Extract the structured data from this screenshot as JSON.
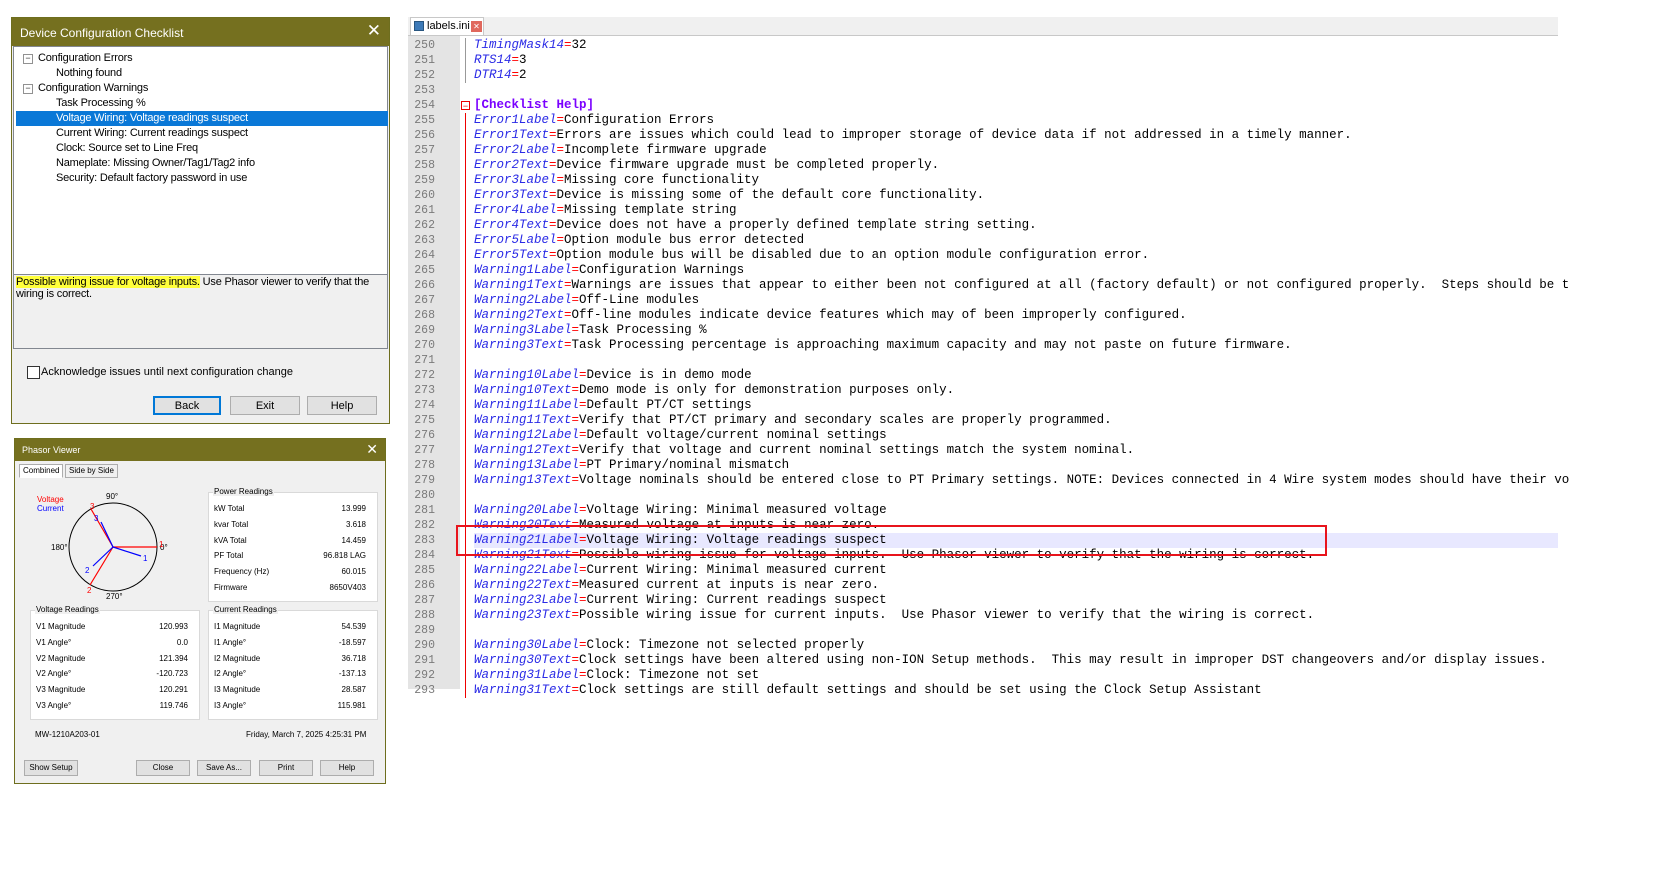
{
  "checklist": {
    "title": "Device Configuration Checklist",
    "close_glyph": "✕",
    "tree": [
      {
        "label": "Configuration Errors",
        "toggle": "−",
        "level": 0
      },
      {
        "label": "Nothing found",
        "level": 1
      },
      {
        "label": "Configuration Warnings",
        "toggle": "−",
        "level": 0
      },
      {
        "label": "Task Processing %",
        "level": 1
      },
      {
        "label": "Voltage Wiring: Voltage readings suspect",
        "level": 1,
        "selected": true
      },
      {
        "label": "Current Wiring: Current readings suspect",
        "level": 1
      },
      {
        "label": "Clock: Source set to Line Freq",
        "level": 1
      },
      {
        "label": "Nameplate: Missing Owner/Tag1/Tag2 info",
        "level": 1
      },
      {
        "label": "Security: Default factory password in use",
        "level": 1
      }
    ],
    "help_highlight": "Possible wiring issue for voltage inputs.",
    "help_rest": " Use Phasor viewer to verify that the wiring is correct.",
    "acknowledge_label": "Acknowledge issues until next configuration change",
    "acknowledge_checked": false,
    "buttons": {
      "back": "Back",
      "exit": "Exit",
      "help": "Help"
    }
  },
  "phasor": {
    "title": "Phasor Viewer",
    "close_glyph": "✕",
    "tabs": [
      "Combined",
      "Side by Side"
    ],
    "legend": {
      "voltage": "Voltage",
      "current": "Current"
    },
    "angles": {
      "top": "90°",
      "left": "180°",
      "right": "0°",
      "bottom": "270°"
    },
    "vector_labels": {
      "v1": "1",
      "v2": "2",
      "v3": "3",
      "i1": "1",
      "i2": "2",
      "i3": "3"
    },
    "colors": {
      "voltage": "#ff0000",
      "current": "#0000ff"
    },
    "power": {
      "title": "Power Readings",
      "rows": [
        {
          "label": "kW Total",
          "value": "13.999"
        },
        {
          "label": "kvar Total",
          "value": "3.618"
        },
        {
          "label": "kVA Total",
          "value": "14.459"
        },
        {
          "label": "PF Total",
          "value": "96.818 LAG"
        },
        {
          "label": "Frequency (Hz)",
          "value": "60.015"
        },
        {
          "label": "Firmware",
          "value": "8650V403"
        }
      ]
    },
    "voltage": {
      "title": "Voltage Readings",
      "rows": [
        {
          "label": "V1 Magnitude",
          "value": "120.993"
        },
        {
          "label": "V1 Angle°",
          "value": "0.0"
        },
        {
          "label": "V2 Magnitude",
          "value": "121.394"
        },
        {
          "label": "V2 Angle°",
          "value": "-120.723"
        },
        {
          "label": "V3 Magnitude",
          "value": "120.291"
        },
        {
          "label": "V3 Angle°",
          "value": "119.746"
        }
      ]
    },
    "current": {
      "title": "Current Readings",
      "rows": [
        {
          "label": "I1 Magnitude",
          "value": "54.539"
        },
        {
          "label": "I1 Angle°",
          "value": "-18.597"
        },
        {
          "label": "I2 Magnitude",
          "value": "36.718"
        },
        {
          "label": "I2 Angle°",
          "value": "-137.13"
        },
        {
          "label": "I3 Magnitude",
          "value": "28.587"
        },
        {
          "label": "I3 Angle°",
          "value": "115.981"
        }
      ]
    },
    "device": "MW-1210A203-01",
    "timestamp": "Friday, March 7, 2025 4:25:31 PM",
    "buttons": {
      "show_setup": "Show Setup",
      "close": "Close",
      "save_as": "Save As...",
      "print": "Print",
      "help": "Help"
    }
  },
  "editor": {
    "tab_name": "labels.ini",
    "tab_close": "✕",
    "lines": [
      {
        "n": "250",
        "key": "TimingMask14",
        "val": "32"
      },
      {
        "n": "251",
        "key": "RTS14",
        "val": "3"
      },
      {
        "n": "252",
        "key": "DTR14",
        "val": "2"
      },
      {
        "n": "253"
      },
      {
        "n": "254",
        "section": "[Checklist Help]"
      },
      {
        "n": "255",
        "key": "Error1Label",
        "val": "Configuration Errors"
      },
      {
        "n": "256",
        "key": "Error1Text",
        "val": "Errors are issues which could lead to improper storage of device data if not addressed in a timely manner."
      },
      {
        "n": "257",
        "key": "Error2Label",
        "val": "Incomplete firmware upgrade"
      },
      {
        "n": "258",
        "key": "Error2Text",
        "val": "Device firmware upgrade must be completed properly."
      },
      {
        "n": "259",
        "key": "Error3Label",
        "val": "Missing core functionality"
      },
      {
        "n": "260",
        "key": "Error3Text",
        "val": "Device is missing some of the default core functionality."
      },
      {
        "n": "261",
        "key": "Error4Label",
        "val": "Missing template string"
      },
      {
        "n": "262",
        "key": "Error4Text",
        "val": "Device does not have a properly defined template string setting."
      },
      {
        "n": "263",
        "key": "Error5Label",
        "val": "Option module bus error detected"
      },
      {
        "n": "264",
        "key": "Error5Text",
        "val": "Option module bus will be disabled due to an option module configuration error."
      },
      {
        "n": "265",
        "key": "Warning1Label",
        "val": "Configuration Warnings"
      },
      {
        "n": "266",
        "key": "Warning1Text",
        "val": "Warnings are issues that appear to either been not configured at all (factory default) or not configured properly.  Steps should be t"
      },
      {
        "n": "267",
        "key": "Warning2Label",
        "val": "Off-Line modules"
      },
      {
        "n": "268",
        "key": "Warning2Text",
        "val": "Off-line modules indicate device features which may of been improperly configured."
      },
      {
        "n": "269",
        "key": "Warning3Label",
        "val": "Task Processing %"
      },
      {
        "n": "270",
        "key": "Warning3Text",
        "val": "Task Processing percentage is approaching maximum capacity and may not paste on future firmware."
      },
      {
        "n": "271"
      },
      {
        "n": "272",
        "key": "Warning10Label",
        "val": "Device is in demo mode"
      },
      {
        "n": "273",
        "key": "Warning10Text",
        "val": "Demo mode is only for demonstration purposes only."
      },
      {
        "n": "274",
        "key": "Warning11Label",
        "val": "Default PT/CT settings"
      },
      {
        "n": "275",
        "key": "Warning11Text",
        "val": "Verify that PT/CT primary and secondary scales are properly programmed."
      },
      {
        "n": "276",
        "key": "Warning12Label",
        "val": "Default voltage/current nominal settings"
      },
      {
        "n": "277",
        "key": "Warning12Text",
        "val": "Verify that voltage and current nominal settings match the system nominal."
      },
      {
        "n": "278",
        "key": "Warning13Label",
        "val": "PT Primary/nominal mismatch"
      },
      {
        "n": "279",
        "key": "Warning13Text",
        "val": "Voltage nominals should be entered close to PT Primary settings. NOTE: Devices connected in 4 Wire system modes should have their vo"
      },
      {
        "n": "280"
      },
      {
        "n": "281",
        "key": "Warning20Label",
        "val": "Voltage Wiring: Minimal measured voltage"
      },
      {
        "n": "282",
        "key": "Warning20Text",
        "val": "Measured voltage at inputs is near zero."
      },
      {
        "n": "283",
        "key": "Warning21Label",
        "val": "Voltage Wiring: Voltage readings suspect",
        "current": true
      },
      {
        "n": "284",
        "key": "Warning21Text",
        "val": "Possible wiring issue for voltage inputs.  Use Phasor viewer to verify that the wiring is correct."
      },
      {
        "n": "285",
        "key": "Warning22Label",
        "val": "Current Wiring: Minimal measured current"
      },
      {
        "n": "286",
        "key": "Warning22Text",
        "val": "Measured current at inputs is near zero."
      },
      {
        "n": "287",
        "key": "Warning23Label",
        "val": "Current Wiring: Current readings suspect"
      },
      {
        "n": "288",
        "key": "Warning23Text",
        "val": "Possible wiring issue for current inputs.  Use Phasor viewer to verify that the wiring is correct."
      },
      {
        "n": "289"
      },
      {
        "n": "290",
        "key": "Warning30Label",
        "val": "Clock: Timezone not selected properly"
      },
      {
        "n": "291",
        "key": "Warning30Text",
        "val": "Clock settings have been altered using non-ION Setup methods.  This may result in improper DST changeovers and/or display issues."
      },
      {
        "n": "292",
        "key": "Warning31Label",
        "val": "Clock: Timezone not set"
      },
      {
        "n": "293",
        "key": "Warning31Text",
        "val": "Clock settings are still default settings and should be set using the Clock Setup Assistant"
      }
    ],
    "annotation_color": "#e8141c"
  }
}
